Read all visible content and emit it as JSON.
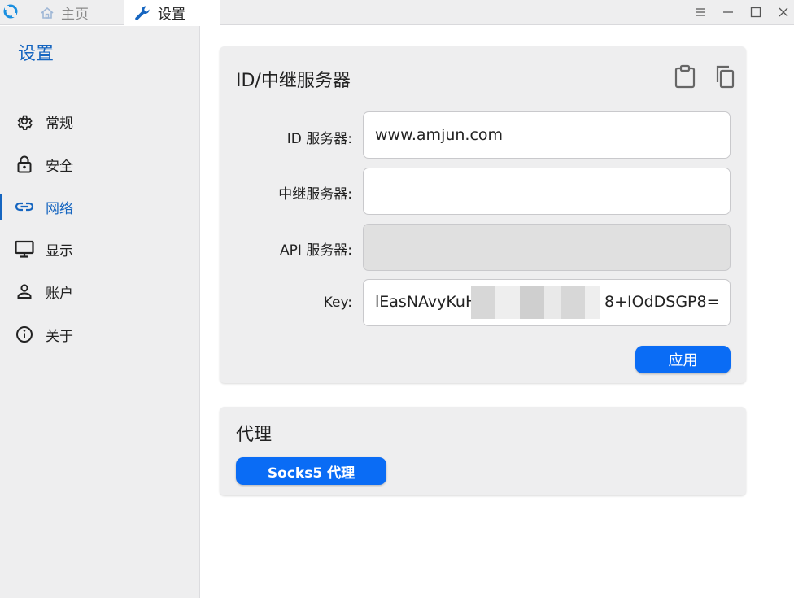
{
  "titlebar": {
    "tabs": [
      {
        "label": "主页",
        "icon": "home-icon",
        "active": false
      },
      {
        "label": "设置",
        "icon": "wrench-icon",
        "active": true
      }
    ],
    "window_controls": [
      "menu-icon",
      "minimize-icon",
      "maximize-icon",
      "close-icon"
    ]
  },
  "sidebar": {
    "title": "设置",
    "items": [
      {
        "label": "常规",
        "icon": "gear-icon"
      },
      {
        "label": "安全",
        "icon": "lock-icon"
      },
      {
        "label": "网络",
        "icon": "link-icon",
        "active": true
      },
      {
        "label": "显示",
        "icon": "monitor-icon"
      },
      {
        "label": "账户",
        "icon": "person-icon"
      },
      {
        "label": "关于",
        "icon": "info-icon"
      }
    ]
  },
  "server_card": {
    "title": "ID/中继服务器",
    "tools": [
      "clipboard-icon",
      "copy-icon"
    ],
    "fields": {
      "id_server": {
        "label": "ID 服务器:",
        "value": "www.amjun.com"
      },
      "relay_server": {
        "label": "中继服务器:",
        "value": ""
      },
      "api_server": {
        "label": "API 服务器:",
        "value": ""
      },
      "key": {
        "label": "Key:",
        "value": "lEasNAvyKuH",
        "value_end": "8+IOdDSGP8="
      }
    },
    "apply_label": "应用"
  },
  "proxy_card": {
    "title": "代理",
    "socks_label": "Socks5 代理"
  },
  "colors": {
    "accent": "#0a6cf5",
    "active_nav": "#1565c0",
    "panel_bg": "#eeeeef"
  }
}
